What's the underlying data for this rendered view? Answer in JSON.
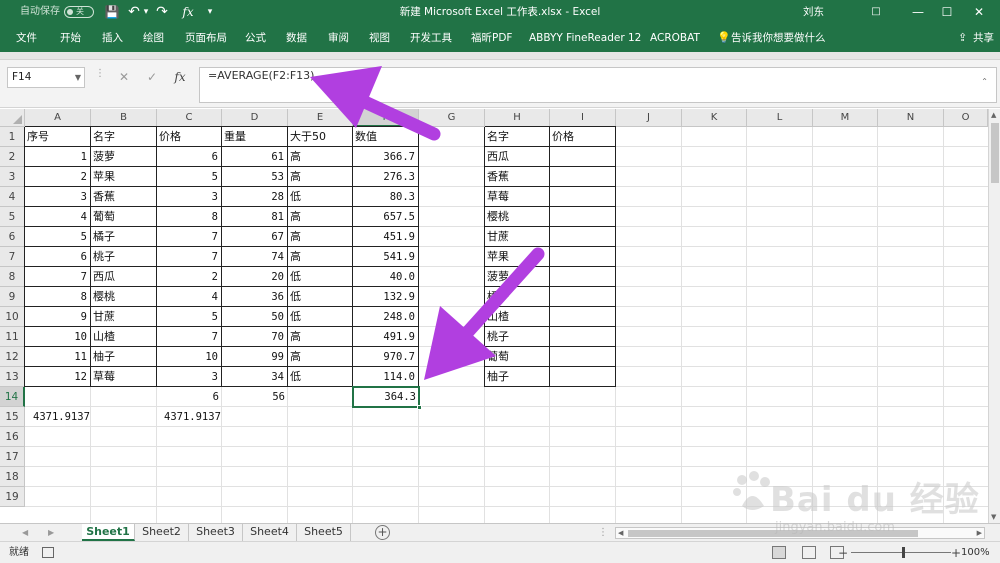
{
  "titlebar": {
    "autosave_label": "自动保存",
    "autosave_state": "关",
    "title": "新建 Microsoft Excel 工作表.xlsx  -  Excel",
    "user": "刘东",
    "controls": {
      "ribbon_display": "□",
      "minimize": "—",
      "restore": "☐",
      "close": "✕"
    },
    "quick_access": {
      "save_icon": "💾",
      "undo_icon": "↶",
      "undo_dropdown": "▾",
      "redo_icon": "↷",
      "fx_icon": "fx",
      "customize_icon": "▾"
    }
  },
  "ribbon": {
    "tabs": [
      "文件",
      "开始",
      "插入",
      "绘图",
      "页面布局",
      "公式",
      "数据",
      "审阅",
      "视图",
      "开发工具",
      "福昕PDF",
      "ABBYY FineReader 12",
      "ACROBAT"
    ],
    "tell_me": "告诉我你想要做什么",
    "share": "共享"
  },
  "formula_bar": {
    "name_box": "F14",
    "cancel": "✕",
    "enter": "✓",
    "fx": "fx",
    "formula": "=AVERAGE(F2:F13)"
  },
  "columns": [
    "A",
    "B",
    "C",
    "D",
    "E",
    "F",
    "G",
    "H",
    "I",
    "J",
    "K",
    "L",
    "M",
    "N",
    "O"
  ],
  "rows": [
    "1",
    "2",
    "3",
    "4",
    "5",
    "6",
    "7",
    "8",
    "9",
    "10",
    "11",
    "12",
    "13",
    "14",
    "15",
    "16",
    "17",
    "18",
    "19"
  ],
  "selected_column": "F",
  "selected_row": "14",
  "table_main": {
    "headers": [
      "序号",
      "名字",
      "价格",
      "重量",
      "大于50",
      "数值"
    ],
    "rows": [
      [
        "1",
        "菠萝",
        "6",
        "61",
        "高",
        "366.7"
      ],
      [
        "2",
        "苹果",
        "5",
        "53",
        "高",
        "276.3"
      ],
      [
        "3",
        "香蕉",
        "3",
        "28",
        "低",
        "80.3"
      ],
      [
        "4",
        "葡萄",
        "8",
        "81",
        "高",
        "657.5"
      ],
      [
        "5",
        "橘子",
        "7",
        "67",
        "高",
        "451.9"
      ],
      [
        "6",
        "桃子",
        "7",
        "74",
        "高",
        "541.9"
      ],
      [
        "7",
        "西瓜",
        "2",
        "20",
        "低",
        "40.0"
      ],
      [
        "8",
        "樱桃",
        "4",
        "36",
        "低",
        "132.9"
      ],
      [
        "9",
        "甘蔗",
        "5",
        "50",
        "低",
        "248.0"
      ],
      [
        "10",
        "山楂",
        "7",
        "70",
        "高",
        "491.9"
      ],
      [
        "11",
        "柚子",
        "10",
        "99",
        "高",
        "970.7"
      ],
      [
        "12",
        "草莓",
        "3",
        "34",
        "低",
        "114.0"
      ]
    ],
    "row14": {
      "price": "6",
      "weight": "56",
      "value": "364.3"
    },
    "row15": {
      "a": "4371.9137",
      "c": "4371.9137"
    }
  },
  "table_side": {
    "headers": [
      "名字",
      "价格"
    ],
    "names": [
      "西瓜",
      "香蕉",
      "草莓",
      "樱桃",
      "甘蔗",
      "苹果",
      "菠萝",
      "橘子",
      "山楂",
      "桃子",
      "葡萄",
      "柚子"
    ]
  },
  "sheets": [
    "Sheet1",
    "Sheet2",
    "Sheet3",
    "Sheet4",
    "Sheet5"
  ],
  "active_sheet": "Sheet1",
  "add_sheet": "+",
  "status": {
    "ready": "就绪",
    "zoom": "100%",
    "zoom_minus": "−",
    "zoom_plus": "+"
  },
  "watermark": {
    "logo": "Bai du 经验",
    "url": "jingyan.baidu.com"
  },
  "colors": {
    "excel_green": "#217346",
    "annotation_arrow": "#b13fe0"
  }
}
